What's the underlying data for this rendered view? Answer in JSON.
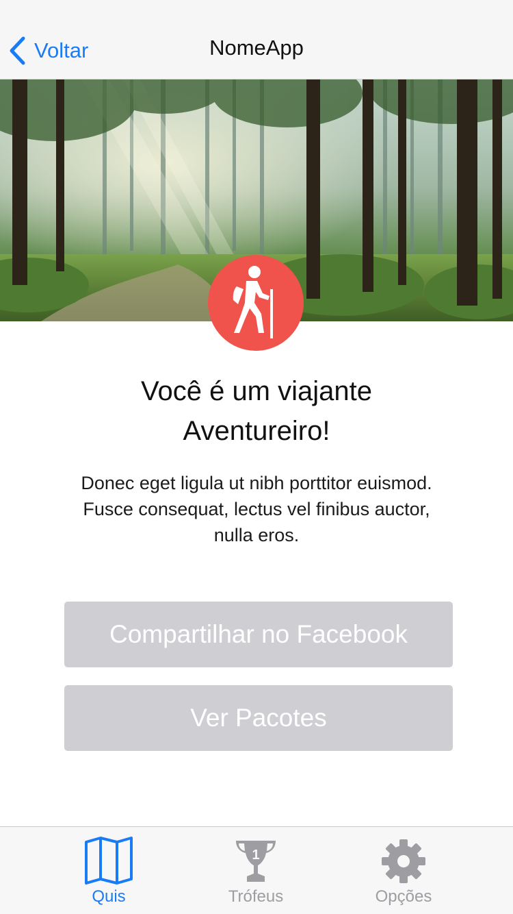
{
  "nav": {
    "back_label": "Voltar",
    "title": "NomeApp"
  },
  "hero": {
    "image": "forest-photo",
    "badge_icon": "hiker-icon",
    "badge_color": "#f0534b"
  },
  "result": {
    "title_line1": "Você é um viajante",
    "title_line2": "Aventureiro!",
    "desc_line1": "Donec eget ligula ut nibh porttitor euismod.",
    "desc_line2": "Fusce consequat, lectus vel finibus auctor,",
    "desc_line3": "nulla eros."
  },
  "buttons": {
    "share": "Compartilhar no Facebook",
    "packages": "Ver Pacotes",
    "color": "#cfcfd3"
  },
  "tabs": [
    {
      "label": "Quis",
      "icon": "map-icon",
      "active": true
    },
    {
      "label": "Trófeus",
      "icon": "trophy-icon",
      "active": false,
      "badge_text": "1"
    },
    {
      "label": "Opções",
      "icon": "gear-icon",
      "active": false
    }
  ],
  "colors": {
    "accent": "#1a7cf5",
    "inactive": "#9d9da2"
  }
}
